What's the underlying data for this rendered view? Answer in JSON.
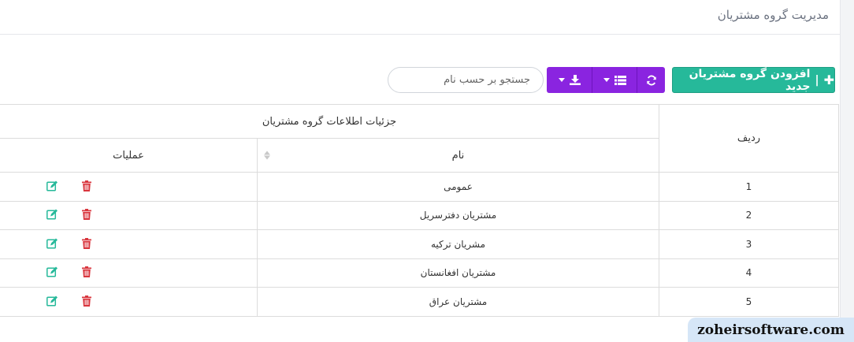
{
  "page": {
    "title": "مدیریت گروه مشتریان"
  },
  "toolbar": {
    "add_label": "افزودن گروه مشتریان جدید",
    "add_icon": "plus-icon",
    "refresh_icon": "refresh-icon",
    "columns_icon": "list-icon",
    "export_icon": "download-icon",
    "search_placeholder": "جستجو بر حسب نام"
  },
  "table": {
    "group_header": "جزئیات اطلاعات گروه مشتریان",
    "col_row": "ردیف",
    "col_name": "نام",
    "col_ops": "عملیات",
    "rows": [
      {
        "row": "1",
        "name": "عمومی"
      },
      {
        "row": "2",
        "name": "مشتریان دفترسریل"
      },
      {
        "row": "3",
        "name": "مشریان ترکیه"
      },
      {
        "row": "4",
        "name": "مشتریان افغانستان"
      },
      {
        "row": "5",
        "name": "مشتریان عراق"
      }
    ]
  },
  "colors": {
    "add_button": "#26b99a",
    "button_group": "#8a24e0",
    "edit_icon": "#26b99a",
    "delete_icon": "#d9363e"
  },
  "watermark": "zoheirsoftware.com"
}
